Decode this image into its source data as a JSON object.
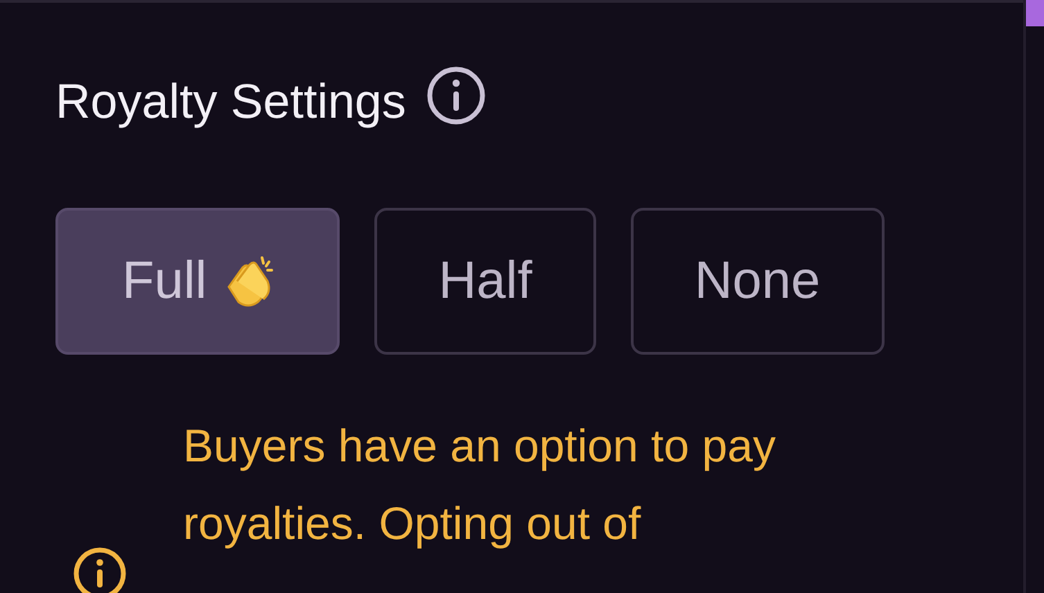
{
  "section": {
    "title": "Royalty Settings"
  },
  "options": [
    {
      "label": "Full",
      "selected": true,
      "has_icon": true
    },
    {
      "label": "Half",
      "selected": false,
      "has_icon": false
    },
    {
      "label": "None",
      "selected": false,
      "has_icon": false
    }
  ],
  "notice": {
    "text": "Buyers have an option to pay royalties. Opting out of"
  }
}
